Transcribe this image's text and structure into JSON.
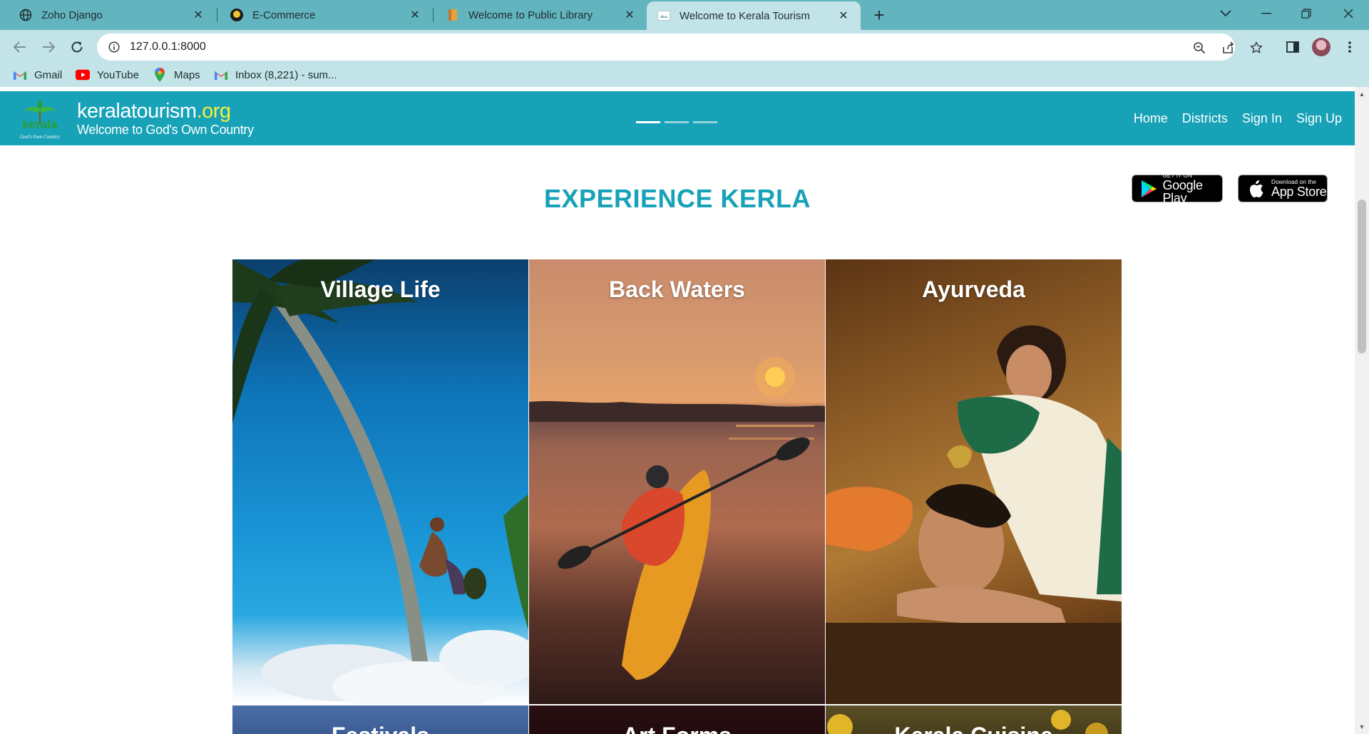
{
  "browser": {
    "tabs": [
      {
        "title": "Zoho Django",
        "icon": "globe-icon"
      },
      {
        "title": "E-Commerce",
        "icon": "e-commerce-favicon"
      },
      {
        "title": "Welcome to Public Library",
        "icon": "library-favicon"
      },
      {
        "title": "Welcome to Kerala Tourism",
        "icon": "kerala-favicon",
        "active": true
      }
    ],
    "url": "127.0.0.1:8000",
    "bookmarks": [
      {
        "label": "Gmail",
        "icon": "gmail-icon"
      },
      {
        "label": "YouTube",
        "icon": "youtube-icon"
      },
      {
        "label": "Maps",
        "icon": "maps-icon"
      },
      {
        "label": "Inbox (8,221) - sum...",
        "icon": "gmail-icon"
      }
    ]
  },
  "site": {
    "brand_name": "keralatourism",
    "brand_tld": ".org",
    "tagline": "Welcome to God's Own Country",
    "logo_text": "kerala",
    "logo_caption": "God's Own Country",
    "nav": [
      "Home",
      "Districts",
      "Sign In",
      "Sign Up"
    ],
    "carousel_indicators": {
      "count": 3,
      "active": 0
    }
  },
  "main": {
    "headline": "EXPERIENCE KERLA",
    "store_badges": [
      {
        "small": "GET IT ON",
        "big": "Google Play"
      },
      {
        "small": "Download on the",
        "big": "App Store"
      }
    ],
    "cards": [
      {
        "title": "Village Life"
      },
      {
        "title": "Back Waters"
      },
      {
        "title": "Ayurveda"
      },
      {
        "title": "Festivals"
      },
      {
        "title": "Art Forms"
      },
      {
        "title": "Kerala Cuisine"
      }
    ]
  },
  "colors": {
    "site_primary": "#17a2b8",
    "tabstrip": "#62b4bf",
    "toolbar": "#c2e4e8",
    "brand_tld": "#f6ef3a"
  }
}
